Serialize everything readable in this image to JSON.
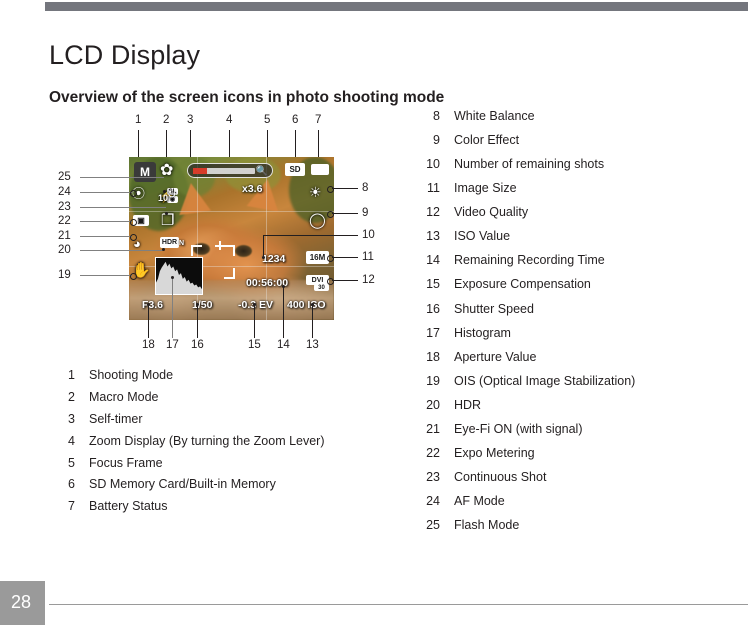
{
  "page": {
    "title": "LCD Display",
    "section_heading": "Overview of the screen icons in photo shooting mode",
    "page_number": "28"
  },
  "colors": {
    "rule": "#74767d",
    "footer_block": "#9a9a9a",
    "text": "#231f20",
    "zoom_fill": "#d63c2a"
  },
  "figure": {
    "top_callouts": [
      "1",
      "2",
      "3",
      "4",
      "5",
      "6",
      "7"
    ],
    "bottom_callouts": [
      "18",
      "17",
      "16",
      "15",
      "14",
      "13"
    ],
    "left_callouts": [
      "25",
      "24",
      "23",
      "22",
      "21",
      "20",
      "19"
    ],
    "right_callouts": [
      "8",
      "9",
      "10",
      "11",
      "12"
    ],
    "lcd_osd": {
      "mode": "M",
      "macro_icon": "macro-flower-icon",
      "flash_icon": "flash-slow-sync-icon",
      "self_timer": "10",
      "self_timer_icon": "self-timer-icon",
      "af_mode_icon": "af-mode-icon",
      "expo_metering_icon": "expo-metering-icon",
      "eyefi_icon": "eye-fi-wifi-icon",
      "continuous_shot_icon": "continuous-shot-icon",
      "hdr_icon": "HDR",
      "hdr_sub": "N",
      "ois_icon": "ois-hand-icon",
      "zoom_factor": "x3.6",
      "zoom_bar_icon": "magnifier-icon",
      "sd_card": "SD",
      "battery_icon": "battery-icon",
      "white_balance_icon": "white-balance-daylight-icon",
      "color_effect_icon": "color-effect-vivid-icon",
      "remaining_shots": "1234",
      "image_size": "16M",
      "video_quality": "DVI",
      "video_quality_sub": "30",
      "recording_time": "00:56:00",
      "aperture": "F3.6",
      "shutter_speed": "1/50",
      "exposure_comp": "-0.3 EV",
      "iso": "400 ISO",
      "histogram_icon": "histogram-icon",
      "focus_frame_icon": "focus-frame-icon"
    }
  },
  "legend_left": [
    {
      "num": "1",
      "label": "Shooting Mode"
    },
    {
      "num": "2",
      "label": "Macro Mode"
    },
    {
      "num": "3",
      "label": "Self-timer"
    },
    {
      "num": "4",
      "label": "Zoom Display (By turning the Zoom Lever)"
    },
    {
      "num": "5",
      "label": "Focus Frame"
    },
    {
      "num": "6",
      "label": "SD Memory Card/Built-in Memory"
    },
    {
      "num": "7",
      "label": "Battery Status"
    }
  ],
  "legend_right": [
    {
      "num": "8",
      "label": "White Balance"
    },
    {
      "num": "9",
      "label": "Color Effect"
    },
    {
      "num": "10",
      "label": "Number of remaining shots"
    },
    {
      "num": "11",
      "label": "Image Size"
    },
    {
      "num": "12",
      "label": "Video Quality"
    },
    {
      "num": "13",
      "label": "ISO Value"
    },
    {
      "num": "14",
      "label": "Remaining Recording Time"
    },
    {
      "num": "15",
      "label": "Exposure Compensation"
    },
    {
      "num": "16",
      "label": "Shutter Speed"
    },
    {
      "num": "17",
      "label": "Histogram"
    },
    {
      "num": "18",
      "label": "Aperture Value"
    },
    {
      "num": "19",
      "label": "OIS (Optical Image Stabilization)"
    },
    {
      "num": "20",
      "label": "HDR"
    },
    {
      "num": "21",
      "label": "Eye-Fi ON (with signal)"
    },
    {
      "num": "22",
      "label": "Expo Metering"
    },
    {
      "num": "23",
      "label": "Continuous Shot"
    },
    {
      "num": "24",
      "label": "AF Mode"
    },
    {
      "num": "25",
      "label": "Flash Mode"
    }
  ]
}
